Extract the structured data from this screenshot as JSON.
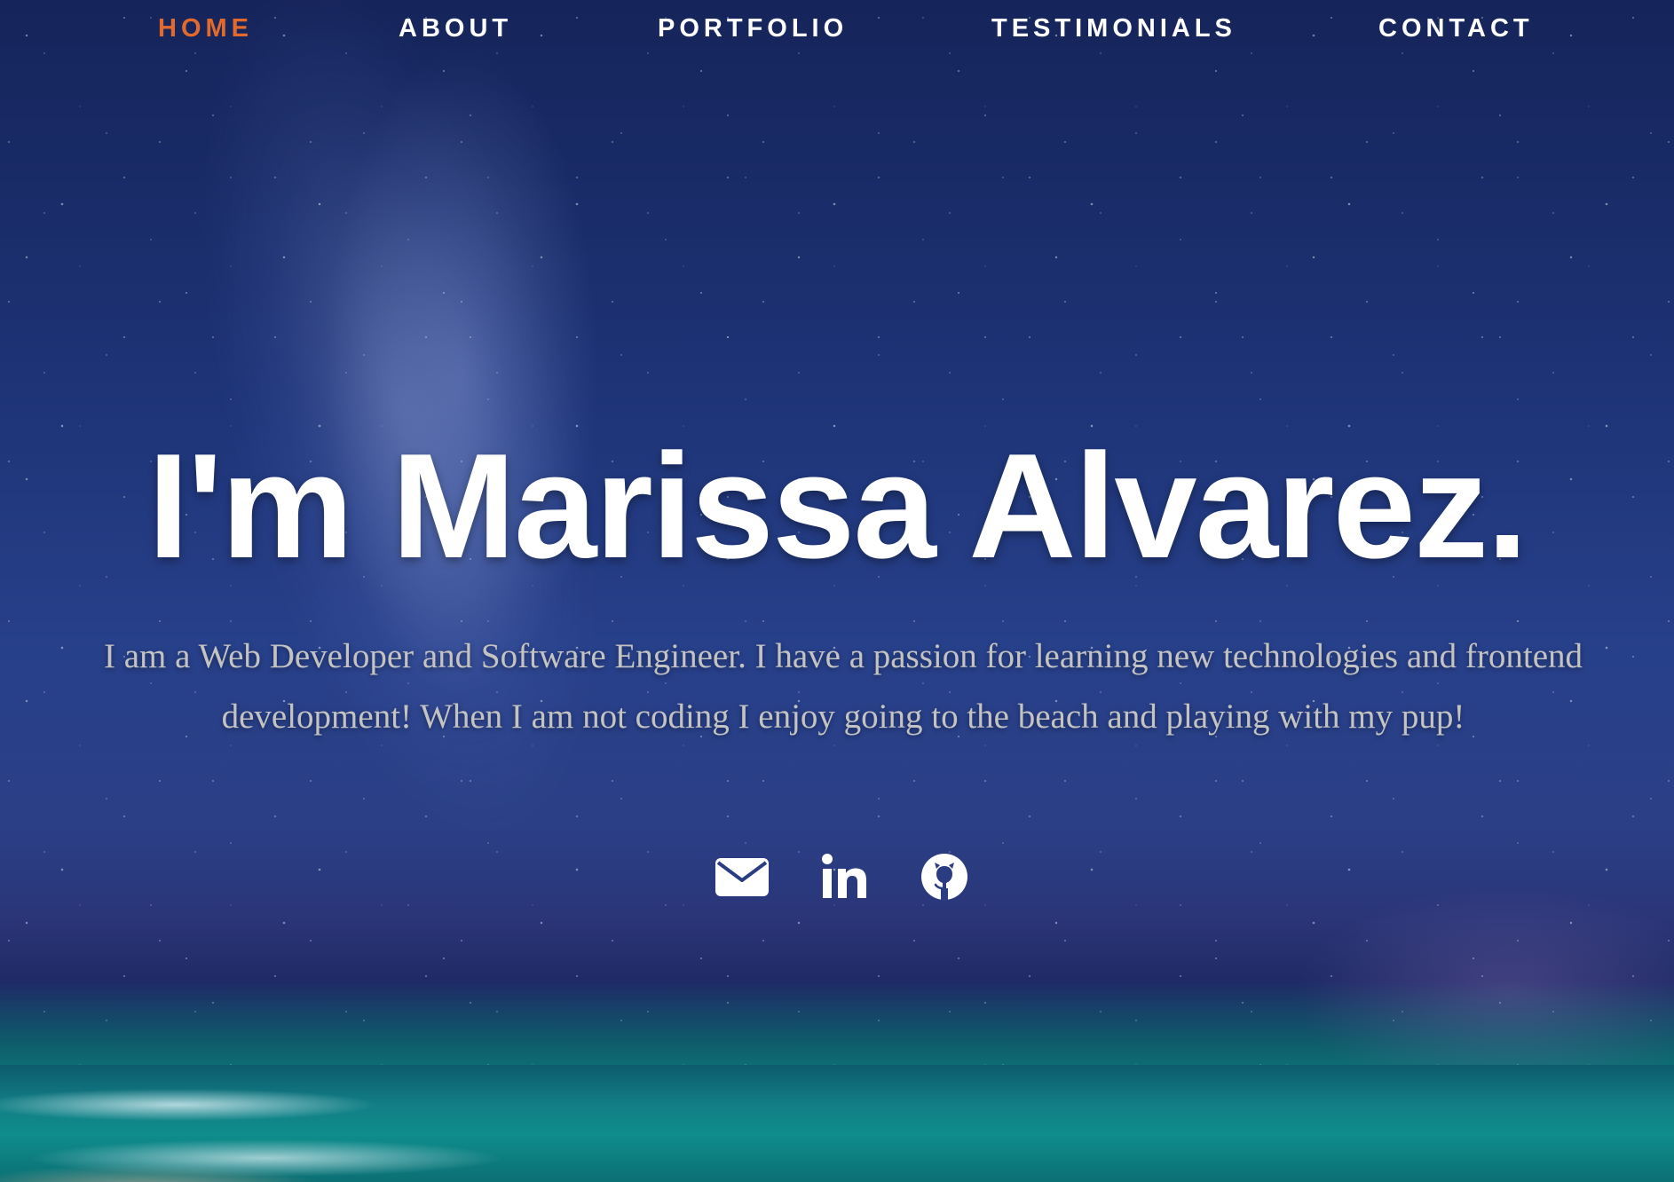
{
  "nav": {
    "items": [
      {
        "label": "HOME",
        "active": true
      },
      {
        "label": "ABOUT",
        "active": false
      },
      {
        "label": "PORTFOLIO",
        "active": false
      },
      {
        "label": "TESTIMONIALS",
        "active": false
      },
      {
        "label": "CONTACT",
        "active": false
      }
    ]
  },
  "hero": {
    "title": "I'm Marissa Alvarez.",
    "bio": "I am a Web Developer and Software Engineer. I have a passion for learning new technologies and frontend development! When I am not coding I enjoy going to the beach and playing with my pup!",
    "social": [
      {
        "icon": "envelope-icon"
      },
      {
        "icon": "linkedin-icon"
      },
      {
        "icon": "github-icon"
      }
    ]
  },
  "colors": {
    "nav_active": "#e26a2c",
    "nav_text": "#ffffff",
    "title": "#ffffff",
    "bio": "#c3c3c3",
    "sky": "#27408a",
    "sea": "#0f8c8c"
  }
}
